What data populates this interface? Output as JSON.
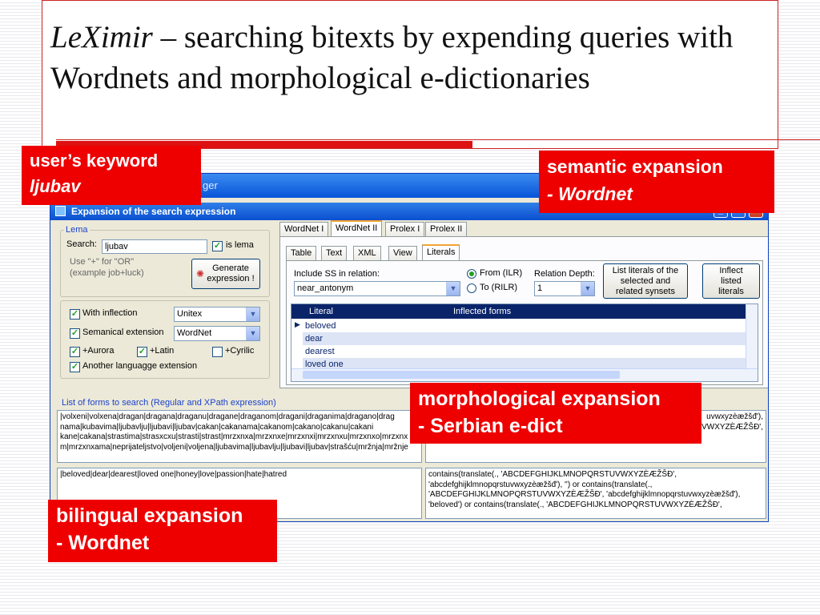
{
  "slide": {
    "title_italic": "LeXimir",
    "title_rest": " – searching bitexts by expending queries with Wordnets and morphological e-dictionaries"
  },
  "callouts": {
    "keyword_line1": "user’s keyword",
    "keyword_line2": "ljubav",
    "semantic_line1": "semantic expansion",
    "semantic_line2": "- Wordnet",
    "morph_line1": "morphological expansion",
    "morph_line2": "- Serbian e-dict",
    "bilingual_line1": "bilingual expansion",
    "bilingual_line2": "- Wordnet"
  },
  "window": {
    "app_title_fragment": "ger",
    "dialog_title": "Expansion of the search expression",
    "controls": {
      "minimize": "_",
      "maximize": "□",
      "close": "×"
    }
  },
  "lema": {
    "group_label": "Lema",
    "search_label": "Search:",
    "search_value": "ljubav",
    "is_lema_label": "is lema",
    "is_lema_checked": true,
    "hint_line1": "Use \"+\" for \"OR\"",
    "hint_line2": "(example job+luck)",
    "generate_button_line1": "Generate",
    "generate_button_line2": "expression !"
  },
  "options": {
    "with_inflection_label": "With inflection",
    "with_inflection_value": "Unitex",
    "semantic_label": "Semanical extension",
    "semantic_value": "WordNet",
    "aurora_label": "+Aurora",
    "latin_label": "+Latin",
    "cyrilic_label": "+Cyrilic",
    "another_label": "Another languagge extension"
  },
  "top_tabs": [
    "WordNet I",
    "WordNet II",
    "Prolex I",
    "Prolex II"
  ],
  "sub_tabs": [
    "Table",
    "Text",
    "XML",
    "View",
    "Literals"
  ],
  "literals": {
    "include_ss_label": "Include SS in relation:",
    "relation_value": "near_antonym",
    "from_label": "From (ILR)",
    "to_label": "To (RILR)",
    "depth_label": "Relation Depth:",
    "depth_value": "1",
    "list_button_line1": "List literals of the",
    "list_button_line2": "selected and",
    "list_button_line3": "related synsets",
    "inflect_button_line1": "Inflect",
    "inflect_button_line2": "listed",
    "inflect_button_line3": "literals",
    "col_literal": "Literal",
    "col_inflected": "Inflected forms",
    "rows": [
      "beloved",
      "dear",
      "dearest",
      "loved one"
    ]
  },
  "forms": {
    "group_label": "List  of forms to search  (Regular and XPath expression)",
    "regex_text": "|volxeni|volxena|dragan|dragana|draganu|dragane|draganom|dragani|draganima|dragano|drag\nnama|kubavima|ljubavlju|ljubavi|ljubav|cakan|cakanama|cakanom|cakano|cakanu|cakani\nkane|cakana|strastima|strasxcxu|strasti|strast|mrzxnxa|mrzxnxe|mrzxnxi|mrzxnxu|mrzxnxo|mrzxnx\nm|mrzxnxama|nepriјateljstvo|voljeni|voljena|ljubavima|ljubavlju|ljubavi|ljubav|strašću|mržnja|mržnje",
    "xpath_text": "uvwxyzèæžšđ'),\n'volxeni') or contains(translate(., 'ABCDEFGHIJKLMNOPQRSTUVWXYZÈÆŽŠĐ',",
    "english_text": "|beloved|dear|dearest|loved one|honey|love|passion|hate|hatred",
    "english_xpath": "contains(translate(., 'ABCDEFGHIJKLMNOPQRSTUVWXYZÈÆŽŠĐ',\n'abcdefghijklmnopqrstuvwxyzèæžšđ'), '') or contains(translate(.,\n'ABCDEFGHIJKLMNOPQRSTUVWXYZÈÆŽŠĐ', 'abcdefghijklmnopqrstuvwxyzèæžšđ'),\n'beloved') or contains(translate(., 'ABCDEFGHIJKLMNOPQRSTUVWXYZÈÆŽŠĐ',"
  }
}
